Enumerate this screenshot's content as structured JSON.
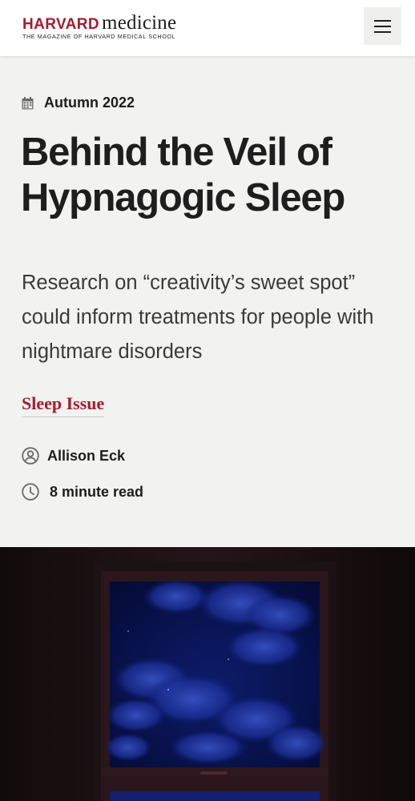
{
  "header": {
    "logo_harvard": "HARVARD",
    "logo_medicine": "medicine",
    "logo_tagline": "THE MAGAZINE OF HARVARD MEDICAL SCHOOL",
    "menu_icon": "hamburger-menu-icon"
  },
  "article": {
    "issue_icon": "calendar-icon",
    "issue": "Autumn 2022",
    "title": "Behind the Veil of Hypnagogic Sleep",
    "dek": "Research on “creativity’s sweet spot” could inform treatments for people with nightmare disorders",
    "tag": "Sleep Issue",
    "author_icon": "user-circle-icon",
    "author": "Allison Eck",
    "read_icon": "clock-icon",
    "read_time": "8 minute read"
  },
  "colors": {
    "brand_crimson": "#a51c30",
    "text_dark": "#1e1e1e",
    "hero_bg": "#f2f2f0",
    "night_sky": "#0a1550"
  }
}
